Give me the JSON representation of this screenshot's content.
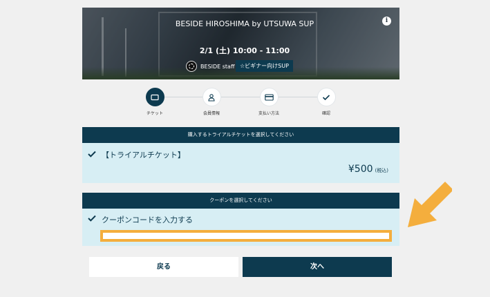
{
  "event": {
    "title": "BESIDE HIROSHIMA by UTSUWA SUP",
    "datetime": "2/1 (土) 10:00 - 11:00",
    "staff_name": "BESIDE staff",
    "tag": "☆ビギナー向けSUP"
  },
  "steps": [
    {
      "label": "チケット",
      "icon": "ticket-icon",
      "active": true
    },
    {
      "label": "会員情報",
      "icon": "user-icon",
      "active": false
    },
    {
      "label": "支払い方法",
      "icon": "credit-card-icon",
      "active": false
    },
    {
      "label": "確認",
      "icon": "check-icon",
      "active": false
    }
  ],
  "ticket_section": {
    "header": "購入するトライアルチケットを選択してください",
    "ticket_name": "【トライアルチケット】",
    "price": "¥500",
    "tax_note": "(税込)"
  },
  "coupon_section": {
    "header": "クーポンを選択してください",
    "option_label": "クーポンコードを入力する",
    "input_value": "",
    "input_placeholder": ""
  },
  "buttons": {
    "back": "戻る",
    "next": "次へ"
  },
  "colors": {
    "primary": "#0d3a4f",
    "panel_bg": "#d7eef4",
    "highlight": "#f4ae3d"
  }
}
